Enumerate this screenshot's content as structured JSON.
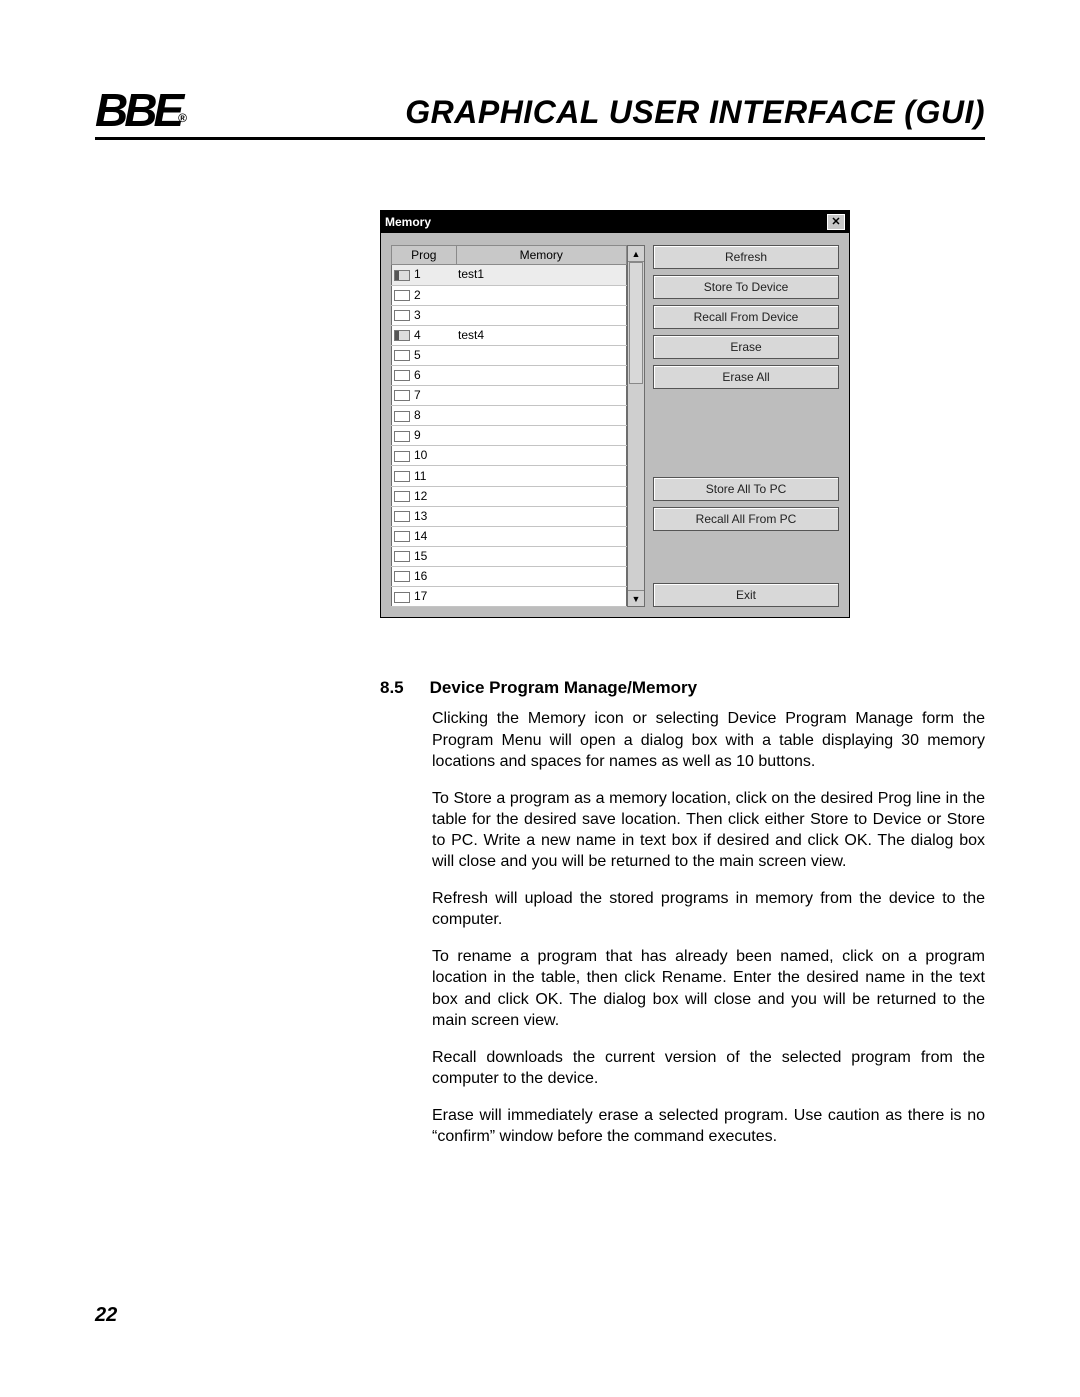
{
  "header": {
    "logo": "BBE",
    "registered": "®",
    "title": "GRAPHICAL USER INTERFACE (GUI)"
  },
  "dialog": {
    "title": "Memory",
    "columns": {
      "prog": "Prog",
      "memory": "Memory"
    },
    "rows": [
      {
        "num": "1",
        "name": "test1",
        "filled": true,
        "selected": true
      },
      {
        "num": "2",
        "name": "",
        "filled": false,
        "selected": false
      },
      {
        "num": "3",
        "name": "",
        "filled": false,
        "selected": false
      },
      {
        "num": "4",
        "name": "test4",
        "filled": true,
        "selected": false
      },
      {
        "num": "5",
        "name": "",
        "filled": false,
        "selected": false
      },
      {
        "num": "6",
        "name": "",
        "filled": false,
        "selected": false
      },
      {
        "num": "7",
        "name": "",
        "filled": false,
        "selected": false
      },
      {
        "num": "8",
        "name": "",
        "filled": false,
        "selected": false
      },
      {
        "num": "9",
        "name": "",
        "filled": false,
        "selected": false
      },
      {
        "num": "10",
        "name": "",
        "filled": false,
        "selected": false
      },
      {
        "num": "11",
        "name": "",
        "filled": false,
        "selected": false
      },
      {
        "num": "12",
        "name": "",
        "filled": false,
        "selected": false
      },
      {
        "num": "13",
        "name": "",
        "filled": false,
        "selected": false
      },
      {
        "num": "14",
        "name": "",
        "filled": false,
        "selected": false
      },
      {
        "num": "15",
        "name": "",
        "filled": false,
        "selected": false
      },
      {
        "num": "16",
        "name": "",
        "filled": false,
        "selected": false
      },
      {
        "num": "17",
        "name": "",
        "filled": false,
        "selected": false
      }
    ],
    "buttons": {
      "refresh": "Refresh",
      "store_device": "Store To Device",
      "recall_device": "Recall From Device",
      "erase": "Erase",
      "erase_all": "Erase All",
      "store_pc": "Store All To PC",
      "recall_pc": "Recall All From PC",
      "exit": "Exit"
    },
    "scroll": {
      "up": "▲",
      "down": "▼"
    }
  },
  "section": {
    "number": "8.5",
    "title": "Device Program Manage/Memory",
    "p1": "Clicking the Memory icon or selecting Device Program Manage form the Program Menu will open a dialog box with a table displaying 30 memory locations and spaces for names as well as 10 buttons.",
    "p2": "To Store a program as a memory location, click on the desired Prog line in the table for the desired save location. Then click either Store to Device or Store to PC. Write a new name in text box if desired and click OK. The dialog box will close and you will be returned to the main screen view.",
    "p3": "Refresh will upload the stored programs in memory from the device to the computer.",
    "p4": "To rename a program that has already been named, click on a program location in the table, then click Rename. Enter the desired name in the text box and click OK. The dialog box will close and you will be returned to the main screen view.",
    "p5": "Recall downloads the current version of the selected program from the computer to the device.",
    "p6": "Erase will immediately erase a selected program. Use caution as there is no “confirm” window before the command executes."
  },
  "page_number": "22"
}
